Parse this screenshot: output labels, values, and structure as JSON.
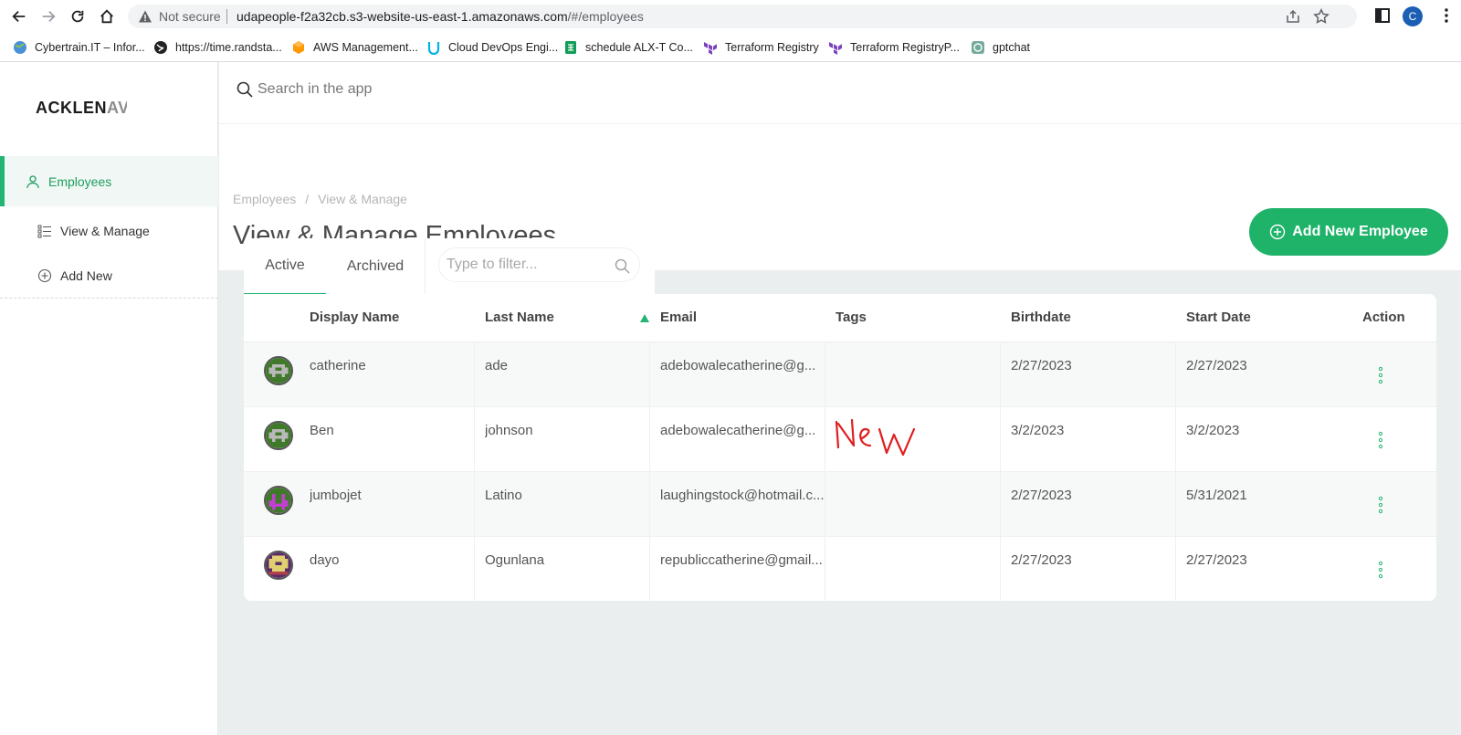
{
  "browser": {
    "not_secure": "Not secure",
    "url_host": "udapeople-f2a32cb.s3-website-us-east-1.amazonaws.com",
    "url_path": "/#/employees",
    "profile_initial": "C",
    "bookmarks": [
      {
        "label": "Cybertrain.IT – Infor...",
        "icon": "globe-colored-icon",
        "color": "#1a73e8"
      },
      {
        "label": "https://time.randsta...",
        "icon": "globe-icon",
        "color": "#202124"
      },
      {
        "label": "AWS Management...",
        "icon": "aws-icon",
        "color": "#ff9900"
      },
      {
        "label": "Cloud DevOps Engi...",
        "icon": "udacity-icon",
        "color": "#02b3e4"
      },
      {
        "label": "schedule ALX-T Co...",
        "icon": "sheets-icon",
        "color": "#0f9d58"
      },
      {
        "label": "Terraform Registry",
        "icon": "terraform-icon",
        "color": "#7b42bc"
      },
      {
        "label": "Terraform RegistryP...",
        "icon": "terraform-icon",
        "color": "#7b42bc"
      },
      {
        "label": "gptchat",
        "icon": "openai-icon",
        "color": "#74aa9c"
      }
    ]
  },
  "app": {
    "logo_main": "ACKLEN",
    "logo_faded": "AV",
    "search_placeholder": "Search in the app",
    "sidebar": {
      "section": "Employees",
      "items": [
        {
          "label": "View & Manage",
          "icon": "list-icon"
        },
        {
          "label": "Add New",
          "icon": "plus-circle-icon"
        }
      ]
    },
    "breadcrumb": [
      "Employees",
      "View & Manage"
    ],
    "page_title": "View & Manage Employees",
    "add_button": "Add New Employee",
    "accent_color": "#1fb36a"
  },
  "tabs": {
    "active": "Active",
    "archived": "Archived",
    "filter_placeholder": "Type to filter..."
  },
  "table": {
    "columns": [
      "Display Name",
      "Last Name",
      "Email",
      "Tags",
      "Birthdate",
      "Start Date",
      "Action"
    ],
    "sorted_column": "Last Name",
    "sort_direction": "ascending",
    "rows": [
      {
        "display_name": "catherine",
        "last_name": "ade",
        "email": "adebowalecatherine@g...",
        "tags": "",
        "birthdate": "2/27/2023",
        "start_date": "2/27/2023",
        "avatar": "green-gray"
      },
      {
        "display_name": "Ben",
        "last_name": "johnson",
        "email": "adebowalecatherine@g...",
        "tags": "",
        "birthdate": "3/2/2023",
        "start_date": "3/2/2023",
        "avatar": "green-gray"
      },
      {
        "display_name": "jumbojet",
        "last_name": "Latino",
        "email": "laughingstock@hotmail.c...",
        "tags": "",
        "birthdate": "2/27/2023",
        "start_date": "5/31/2021",
        "avatar": "green-purple"
      },
      {
        "display_name": "dayo",
        "last_name": "Ogunlana",
        "email": "republiccatherine@gmail...",
        "tags": "",
        "birthdate": "2/27/2023",
        "start_date": "2/27/2023",
        "avatar": "purple-yellow"
      }
    ]
  }
}
